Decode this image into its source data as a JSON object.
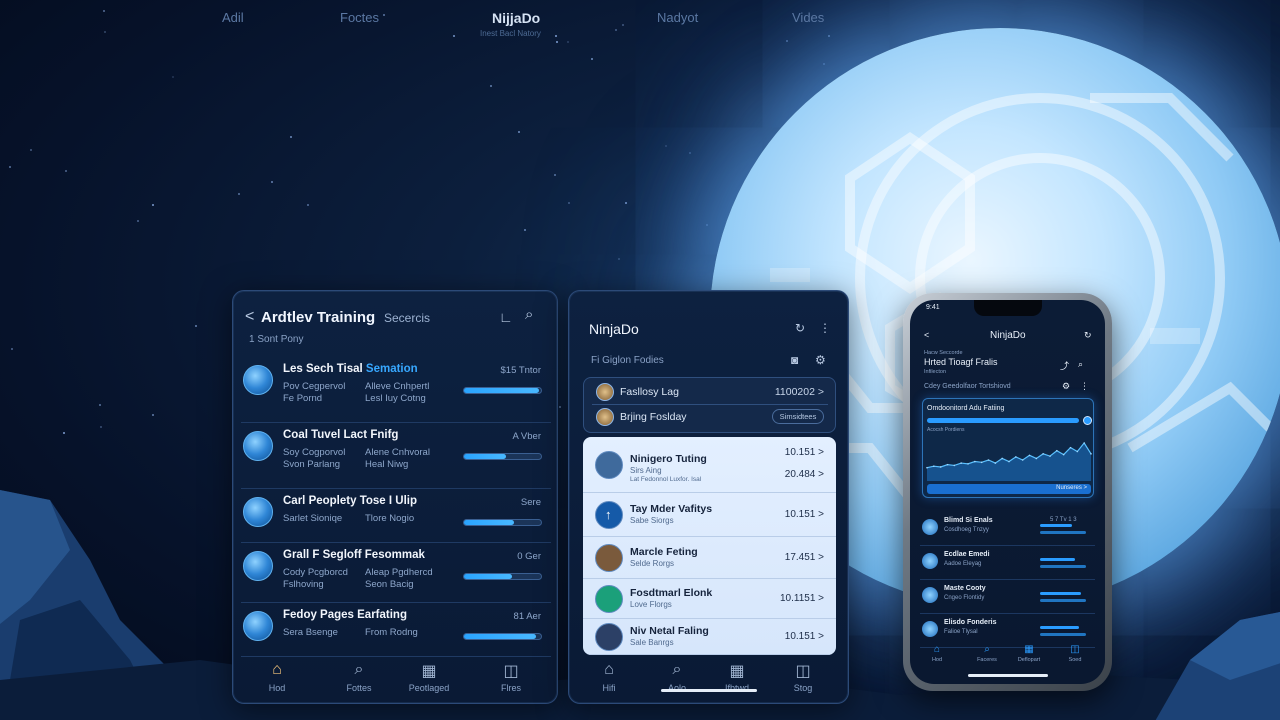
{
  "top_nav": {
    "items": [
      "Adil",
      "Foctes",
      "Nadyot",
      "Vides"
    ],
    "brand": "NijjaDo",
    "brand_sub": "Inest Bacl Natory"
  },
  "panel1": {
    "back": "<",
    "title": "Ardtlev Training",
    "search_label": "Secercis",
    "subtitle": "1 Sont Pony",
    "rows": [
      {
        "title": "Les Sech Tisal",
        "title_hl": "Semation",
        "col1": [
          "Pov Cegpervol",
          "Fe Pornd"
        ],
        "col2": [
          "Alleve Cnhpertl",
          "Lesl Iuy Cotng"
        ],
        "meta": "$15 Tntor",
        "progress": 0.98
      },
      {
        "title": "Coal Tuvel Lact Fnifg",
        "title_hl": "",
        "col1": [
          "Soy Cogporvol",
          "Svon Parlang"
        ],
        "col2": [
          "Alene Cnhvoral",
          "Heal Niwg"
        ],
        "meta": "A Vber",
        "progress": 0.55
      },
      {
        "title": "Carl Peoplety Tose I Ulip",
        "title_hl": "",
        "col1": [
          "Sarlet Sioniqe"
        ],
        "col2": [
          "Tlore Nogio"
        ],
        "meta": "Sere",
        "progress": 0.65
      },
      {
        "title": "Grall F Segloff Fesommak",
        "title_hl": "",
        "col1": [
          "Cody Pcgborcd",
          "Fslhoving"
        ],
        "col2": [
          "Aleap Pgdhercd",
          "Seon Bacig"
        ],
        "meta": "0 Ger",
        "progress": 0.62
      },
      {
        "title": "Fedoy Pages Earfating",
        "title_hl": "",
        "col1": [
          "Sera Bsenge"
        ],
        "col2": [
          "From Rodng"
        ],
        "meta": "81 Aer",
        "progress": 0.93
      }
    ],
    "tabs": [
      {
        "icon": "⌂",
        "label": "Hod"
      },
      {
        "icon": "⌕",
        "label": "Fottes"
      },
      {
        "icon": "▦",
        "label": "Peotlaged"
      },
      {
        "icon": "◫",
        "label": "Flres"
      }
    ]
  },
  "panel2": {
    "title": "NinjaDo",
    "section": "Fi Giglon Fodies",
    "seg_rows": [
      {
        "label": "Fasllosy Lag",
        "value": "1100202 >"
      },
      {
        "label": "Brjing Foslday",
        "pill": "Simsidtees"
      }
    ],
    "list": [
      {
        "title": "Ninigero Tuting",
        "sub1": "Sirs Aing",
        "sub2": "Lat Fedonnol Luxfor. Isal",
        "v1": "10.151 >",
        "v2": "20.484 >",
        "avatar_color": "#3f6a9c"
      },
      {
        "title": "Tay Mder Vafitys",
        "sub1": "Sabe Siorgs",
        "v1": "10.151 >",
        "avatar_color": "#155aa8"
      },
      {
        "title": "Marcle Feting",
        "sub1": "Selde Rorgs",
        "v1": "17.451 >",
        "avatar_color": "#7a5a3c"
      },
      {
        "title": "Fosdtmarl Elonk",
        "sub1": "Love Florgs",
        "v1": "10.1151 >",
        "avatar_color": "#1ba07a"
      },
      {
        "title": "Niv Netal Faling",
        "sub1": "Sale Banrgs",
        "v1": "10.151 >",
        "avatar_color": "#2c4066"
      }
    ],
    "tabs": [
      {
        "icon": "⌂",
        "label": "Hifi"
      },
      {
        "icon": "⌕",
        "label": "Aolo"
      },
      {
        "icon": "▦",
        "label": "Ifbtwd"
      },
      {
        "icon": "◫",
        "label": "Stog"
      }
    ]
  },
  "phone": {
    "status_time": "9:41",
    "title": "NinjaDo",
    "heading_small": "Hacw Seccorde",
    "heading": "Hrted Tioagf Fralis",
    "heading_sub": "Infilecton",
    "section": "Cdey Geedolfaor Tortshiovd",
    "card_title": "Omdoonitord Adu Fatiing",
    "card_button": "Acocsh Pordiens",
    "card_action": "Nunseres >",
    "rows": [
      {
        "title": "Blimd Si Enals",
        "sub": "Cosdhoeg Tnzyy",
        "meta": "5 7 Tv 1 3",
        "progress": 0.7
      },
      {
        "title": "Ecdlae Emedi",
        "sub": "Aadoe Eleyag",
        "progress": 0.75
      },
      {
        "title": "Maste Cooty",
        "sub": "Cngeo Flontidy",
        "progress": 0.9
      },
      {
        "title": "Elisdo Fonderis",
        "sub": "Falioe Tlysal",
        "progress": 0.85
      }
    ],
    "tabs": [
      {
        "icon": "⌂",
        "label": "Hod"
      },
      {
        "icon": "⌕",
        "label": "Faceres"
      },
      {
        "icon": "▦",
        "label": "Deflopart"
      },
      {
        "icon": "◫",
        "label": "Soed"
      }
    ],
    "chart_data": {
      "type": "area",
      "values": [
        12,
        14,
        13,
        16,
        15,
        18,
        17,
        20,
        19,
        22,
        18,
        24,
        20,
        26,
        22,
        28,
        24,
        30,
        27,
        34,
        29,
        38,
        33,
        44,
        30
      ]
    }
  },
  "colors": {
    "accent": "#2aa4ff",
    "panel_bg": "#0a1a35",
    "light_list": "#dde9fb"
  }
}
